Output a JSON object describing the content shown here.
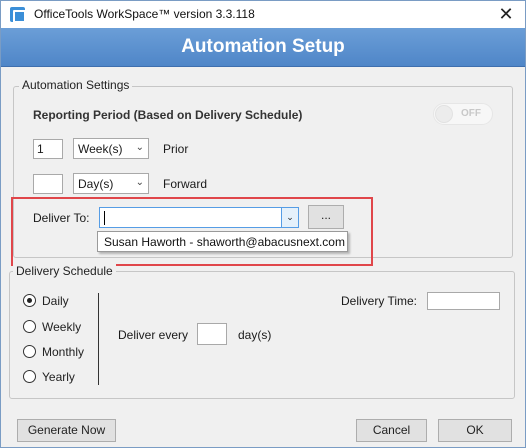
{
  "window": {
    "title": "OfficeTools WorkSpace™ version 3.3.118",
    "close_glyph": "✕"
  },
  "header": {
    "title": "Automation Setup"
  },
  "automation_settings": {
    "legend": "Automation Settings",
    "reporting_period_label": "Reporting Period (Based on Delivery Schedule)",
    "toggle_text": "OFF",
    "prior": {
      "value": "1",
      "unit": "Week(s)",
      "label": "Prior"
    },
    "forward": {
      "value": "",
      "unit": "Day(s)",
      "label": "Forward"
    },
    "deliver_to_label": "Deliver To:",
    "deliver_to_value": "",
    "ellipsis_label": "...",
    "dropdown_option": "Susan  Haworth - shaworth@abacusnext.com"
  },
  "delivery_schedule": {
    "legend": "Delivery Schedule",
    "options": [
      "Daily",
      "Weekly",
      "Monthly",
      "Yearly"
    ],
    "selected": "Daily",
    "deliver_every_label": "Deliver every",
    "deliver_every_value": "",
    "days_label": "day(s)",
    "delivery_time_label": "Delivery Time:",
    "delivery_time_value": ""
  },
  "buttons": {
    "generate_now": "Generate Now",
    "cancel": "Cancel",
    "ok": "OK"
  },
  "icons": {
    "app": "app-icon",
    "dropdown_arrow": "⌄"
  },
  "colors": {
    "header_blue": "#5a8fcf",
    "highlight_red": "#e0464a",
    "focus_blue": "#569de5"
  }
}
